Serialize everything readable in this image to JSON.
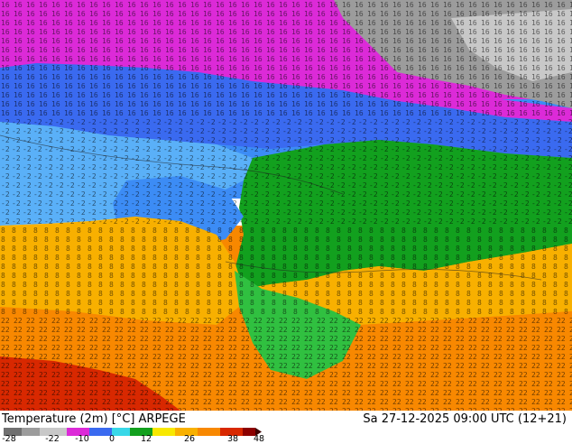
{
  "map": {
    "colors": {
      "deep_magenta": "#b400c8",
      "magenta": "#dc2ad8",
      "light_magenta": "#e867e4",
      "purple_blue": "#7068e6",
      "royal_blue": "#3a6af0",
      "blue": "#3c8cf5",
      "sky_blue": "#5ab0f8",
      "cyan": "#38d8e8",
      "light_green": "#30c040",
      "green": "#12a01e",
      "dark_green": "#0a8c18",
      "yellow": "#f8e800",
      "amber": "#f8b000",
      "orange": "#f88800",
      "dark_orange": "#e86000",
      "red": "#d82800",
      "grey": "#9c9c9c",
      "light_grey": "#c8c8c8"
    }
  },
  "footer": {
    "title": "Temperature (2m) [°C] ARPEGE",
    "run_info": "Sa 27-12-2025 09:00 UTC (12+21)",
    "legend_ticks": [
      "-28",
      "-22",
      "-10",
      "0",
      "12",
      "26",
      "38",
      "48"
    ]
  }
}
